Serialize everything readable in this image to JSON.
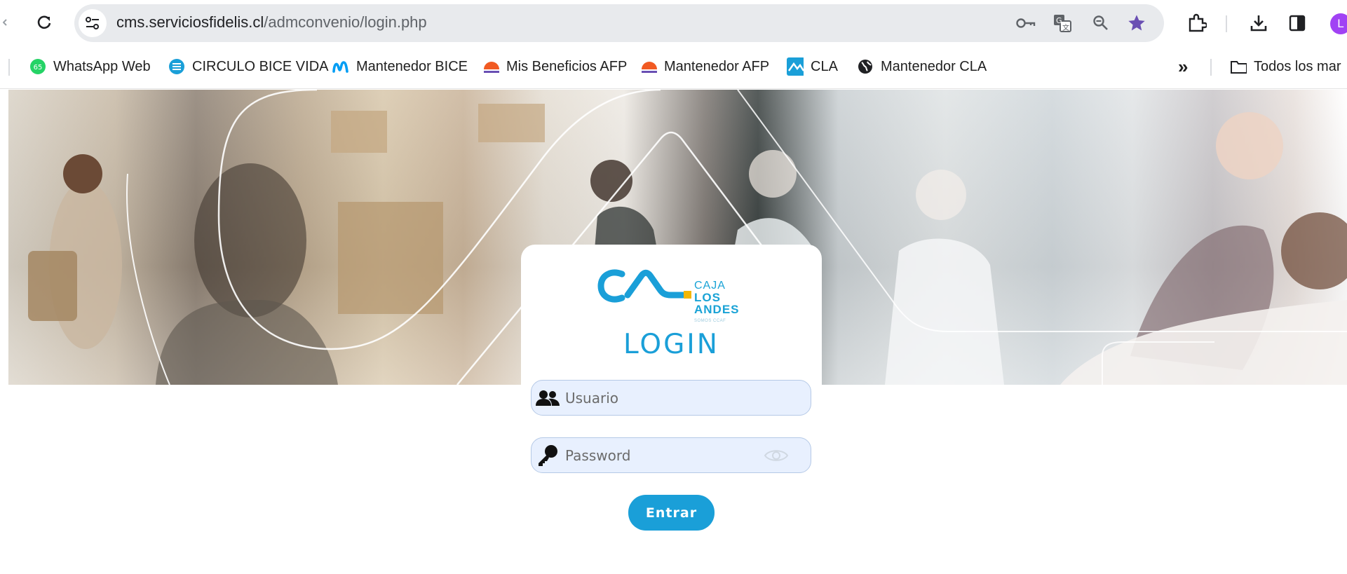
{
  "browser": {
    "url_host": "cms.serviciosfidelis.cl",
    "url_path": "/admconvenio/login.php",
    "avatar_letter": "L",
    "icons": [
      "reload-icon",
      "site-info-icon",
      "password-key-icon",
      "translate-icon",
      "zoom-icon",
      "star-icon",
      "extensions-icon",
      "download-icon",
      "side-panel-icon"
    ]
  },
  "bookmarks": {
    "items": [
      {
        "label": "WhatsApp Web",
        "badge": "65",
        "icon": "whatsapp-icon",
        "color": "#25d366"
      },
      {
        "label": "CIRCULO BICE VIDA",
        "icon": "bice-icon",
        "color": "#1a9fd8"
      },
      {
        "label": "Mantenedor BICE",
        "icon": "movistar-icon",
        "color": "#019df4"
      },
      {
        "label": "Mis Beneficios AFP",
        "icon": "afp-icon",
        "color": "#f15a22"
      },
      {
        "label": "Mantenedor AFP",
        "icon": "afp-icon",
        "color": "#f15a22"
      },
      {
        "label": "CLA",
        "icon": "cla-icon",
        "color": "#1a9fd8"
      },
      {
        "label": "Mantenedor CLA",
        "icon": "globe-icon",
        "color": "#202124"
      }
    ],
    "overflow": "»",
    "all_bookmarks": "Todos los mar"
  },
  "login": {
    "brand_line1": "CAJA",
    "brand_line2": "LOS",
    "brand_line3": "ANDES",
    "brand_tagline": "SOMOS CCAF",
    "title": "LOGIN",
    "username_placeholder": "Usuario",
    "password_placeholder": "Password",
    "submit_label": "Entrar"
  },
  "colors": {
    "accent": "#1a9fd8",
    "brand_yellow": "#f2b705",
    "field_bg": "#e8f0fe"
  }
}
